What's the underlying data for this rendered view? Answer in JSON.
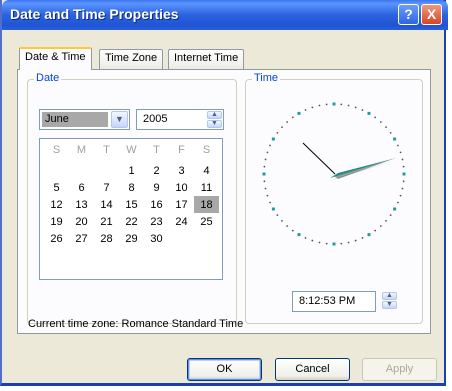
{
  "window": {
    "title": "Date and Time Properties",
    "help_label": "?",
    "close_label": "X"
  },
  "tabs": [
    {
      "label": "Date & Time"
    },
    {
      "label": "Time Zone"
    },
    {
      "label": "Internet Time"
    }
  ],
  "date_group": {
    "legend": "Date",
    "month": "June",
    "year": "2005",
    "weekdays": [
      "S",
      "M",
      "T",
      "W",
      "T",
      "F",
      "S"
    ],
    "weeks": [
      [
        "",
        "",
        "",
        "1",
        "2",
        "3",
        "4"
      ],
      [
        "5",
        "6",
        "7",
        "8",
        "9",
        "10",
        "11"
      ],
      [
        "12",
        "13",
        "14",
        "15",
        "16",
        "17",
        "18"
      ],
      [
        "19",
        "20",
        "21",
        "22",
        "23",
        "24",
        "25"
      ],
      [
        "26",
        "27",
        "28",
        "29",
        "30",
        "",
        ""
      ]
    ],
    "selected_day": "18"
  },
  "time_group": {
    "legend": "Time",
    "time": "8:12:53 PM"
  },
  "timezone_text": "Current time zone:  Romance Standard Time",
  "buttons": {
    "ok": "OK",
    "cancel": "Cancel",
    "apply": "Apply"
  },
  "colors": {
    "title_bar": "#2c62de",
    "accent": "#0046d5",
    "clock_hand": "#1f8c8c"
  }
}
